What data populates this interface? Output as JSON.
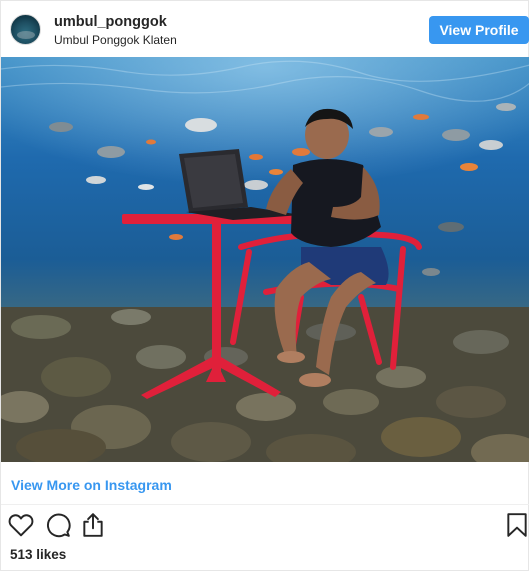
{
  "post": {
    "username": "umbul_ponggok",
    "location": "Umbul Ponggok Klaten",
    "view_profile_label": "View Profile",
    "view_more_label": "View More on Instagram",
    "likes_text": "513 likes"
  },
  "icons": {
    "avatar": "profile-avatar",
    "like": "heart-icon",
    "comment": "comment-bubble-icon",
    "share": "share-upload-icon",
    "save": "bookmark-icon"
  },
  "colors": {
    "accent": "#3897f0",
    "text": "#262626",
    "border": "#efefef"
  }
}
